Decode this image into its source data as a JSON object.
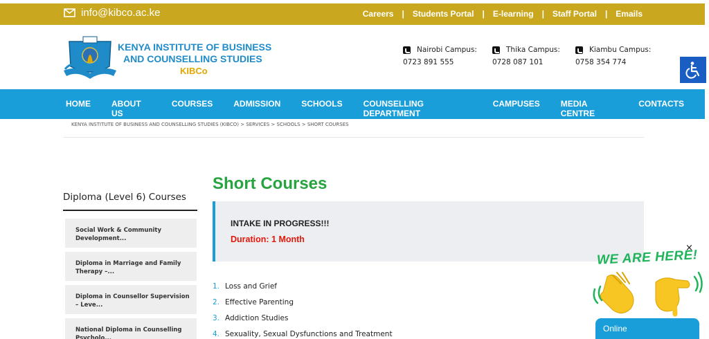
{
  "topbar": {
    "email": "info@kibco.ac.ke",
    "links": [
      "Careers",
      "Students Portal",
      "E-learning",
      "Staff Portal",
      "Emails"
    ]
  },
  "logo": {
    "line1": "KENYA INSTITUTE OF BUSINESS",
    "line2": "AND COUNSELLING  STUDIES",
    "line3": "KIBCo"
  },
  "campuses": [
    {
      "name": "Nairobi Campus:",
      "phone": "0723 891 555"
    },
    {
      "name": "Thika Campus:",
      "phone": "0728 087 101"
    },
    {
      "name": "Kiambu Campus:",
      "phone": "0758 354 774"
    }
  ],
  "nav": [
    "HOME",
    "ABOUT US",
    "COURSES",
    "ADMISSION",
    "SCHOOLS",
    "COUNSELLING DEPARTMENT",
    "CAMPUSES",
    "MEDIA CENTRE",
    "CONTACTS"
  ],
  "breadcrumb": "KENYA INSTITUTE OF BUSINESS AND COUNSELLING STUDIES (KIBCO) > SERVICES > SCHOOLS > SHORT COURSES",
  "sidebar": {
    "title": "Diploma (Level 6) Courses",
    "items": [
      "Social Work & Community Development...",
      "Diploma in Marriage and Family Therapy –...",
      "Diploma in Counsellor Supervision – Leve...",
      "National Diploma in Counselling Psycholo..."
    ]
  },
  "main": {
    "title": "Short Courses",
    "intake_heading": "INTAKE IN PROGRESS!!!",
    "duration": "Duration: 1 Month",
    "courses": [
      {
        "num": "1.",
        "name": "Loss and Grief"
      },
      {
        "num": "2.",
        "name": "Effective Parenting"
      },
      {
        "num": "3.",
        "name": "Addiction Studies"
      },
      {
        "num": "4.",
        "name": "Sexuality, Sexual Dysfunctions and Treatment"
      }
    ]
  },
  "widget": {
    "close": "×",
    "banner": "WE ARE HERE!",
    "status": "Online"
  }
}
